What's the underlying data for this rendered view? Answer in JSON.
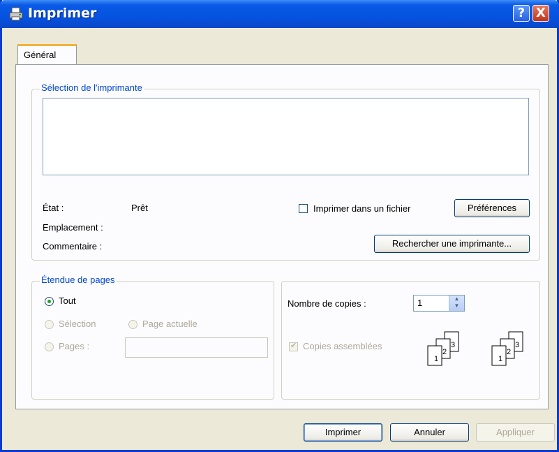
{
  "window": {
    "title": "Imprimer",
    "help_button": "?",
    "close_button": "X"
  },
  "tabs": [
    {
      "label": "Général"
    }
  ],
  "printer_group": {
    "legend": "Sélection de l'imprimante",
    "status_label": "État :",
    "status_value": "Prêt",
    "location_label": "Emplacement :",
    "comment_label": "Commentaire :",
    "print_to_file_label": "Imprimer dans un fichier",
    "preferences_button": "Préférences",
    "find_printer_button": "Rechercher une imprimante..."
  },
  "page_range": {
    "legend": "Étendue de pages",
    "all_label": "Tout",
    "selection_label": "Sélection",
    "current_page_label": "Page actuelle",
    "pages_label": "Pages :",
    "pages_value": ""
  },
  "copies": {
    "count_label": "Nombre de copies :",
    "count_value": "1",
    "collate_label": "Copies assemblées",
    "collate_icon_labels": [
      "1",
      "2",
      "3"
    ]
  },
  "footer": {
    "print_button": "Imprimer",
    "cancel_button": "Annuler",
    "apply_button": "Appliquer"
  },
  "colors": {
    "title_bar": "#0553e0",
    "legend_text": "#0046d5",
    "dialog_bg": "#ece9d8",
    "close": "#c2341a"
  },
  "icons": [
    "printer-icon",
    "help-icon",
    "close-icon",
    "spin-up-icon",
    "spin-down-icon",
    "collated-pages-icon"
  ]
}
